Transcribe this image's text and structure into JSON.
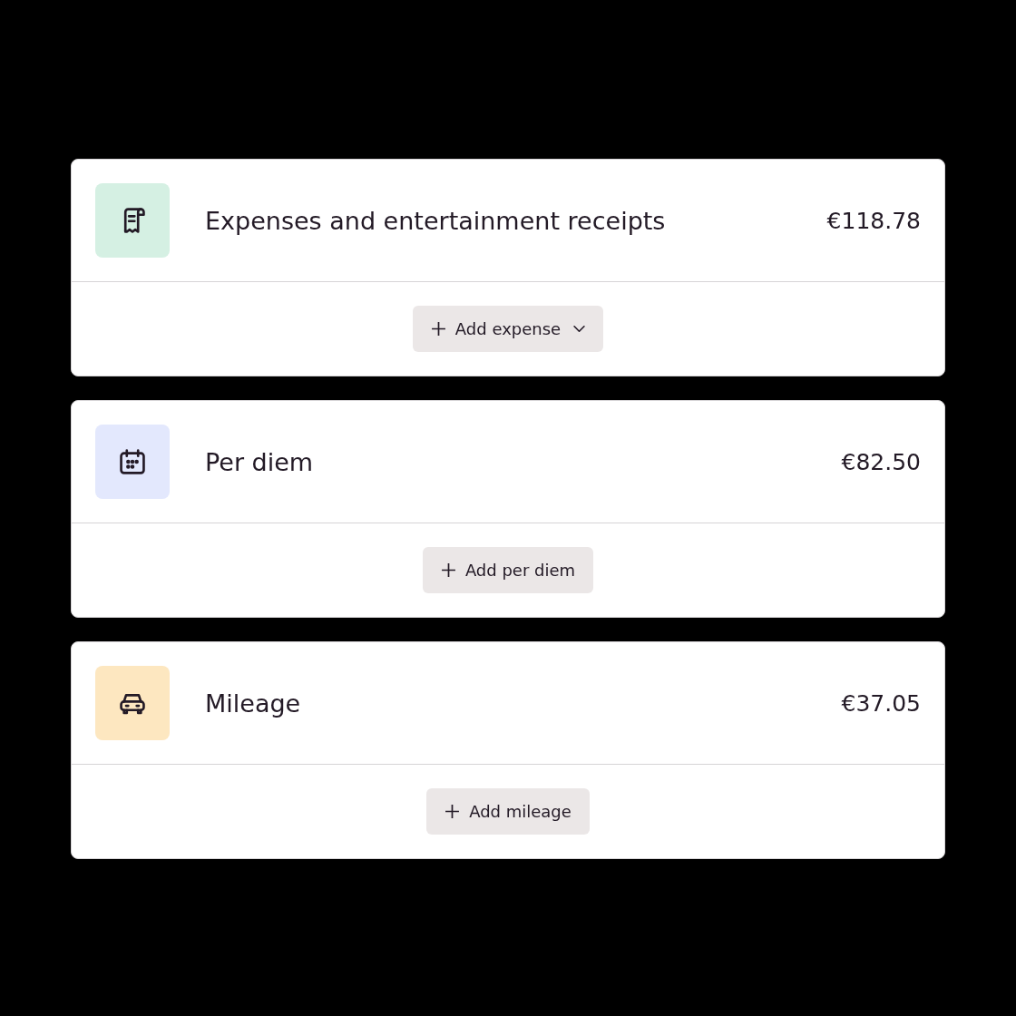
{
  "sections": [
    {
      "kind": "receipt",
      "color": "#d5f0e3",
      "title": "Expenses and entertainment receipts",
      "amount": "€118.78",
      "button": {
        "label": "Add expense",
        "has_menu": true
      }
    },
    {
      "kind": "calendar",
      "color": "#e3e8fd",
      "title": "Per diem",
      "amount": "€82.50",
      "button": {
        "label": "Add per diem",
        "has_menu": false
      }
    },
    {
      "kind": "car",
      "color": "#fde7c0",
      "title": "Mileage",
      "amount": "€37.05",
      "button": {
        "label": "Add mileage",
        "has_menu": false
      }
    }
  ]
}
